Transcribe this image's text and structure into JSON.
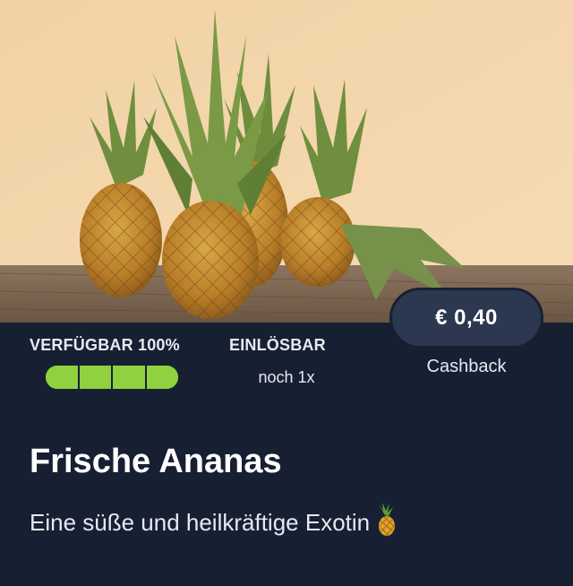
{
  "offer": {
    "price": "€ 0,40",
    "cashback_label": "Cashback",
    "availability_label": "VERFÜGBAR 100%",
    "availability_fraction": 1.0,
    "redeemable_label": "EINLÖSBAR",
    "redeemable_value": "noch 1x",
    "title": "Frische Ananas",
    "subtitle": "Eine süße und heilkräftige Exotin",
    "subtitle_icon": "pineapple-icon"
  },
  "colors": {
    "background": "#172033",
    "pill": "#2b3850",
    "progress": "#8fd13f"
  }
}
